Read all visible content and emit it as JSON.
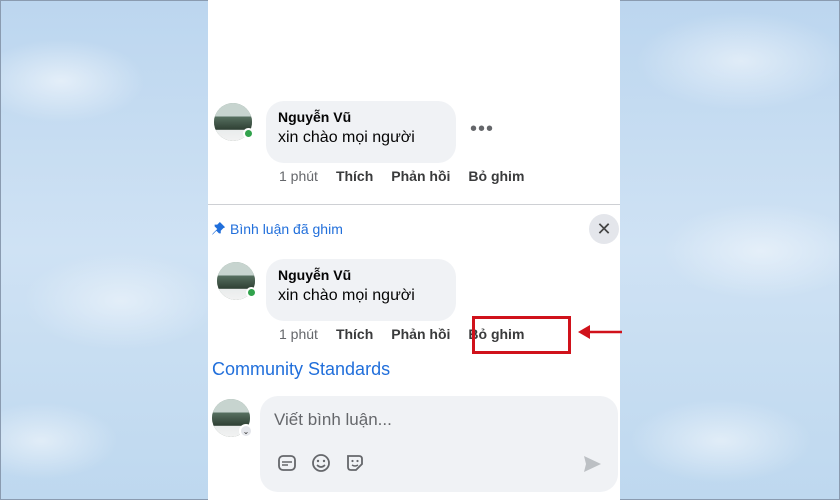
{
  "comment": {
    "author": "Nguyễn Vũ",
    "text": "xin chào mọi người",
    "time": "1 phút",
    "like": "Thích",
    "reply": "Phản hồi",
    "unpin": "Bỏ ghim",
    "more": "•••"
  },
  "pinned_section": {
    "label": "Bình luận đã ghim",
    "close": "✕",
    "comment": {
      "author": "Nguyễn Vũ",
      "text": "xin chào mọi người",
      "time": "1 phút",
      "like": "Thích",
      "reply": "Phản hồi",
      "unpin": "Bỏ ghim"
    }
  },
  "community_link": "Community Standards",
  "composer": {
    "placeholder": "Viết bình luận...",
    "avatar_badge": "⌄"
  },
  "colors": {
    "accent": "#216fdb",
    "highlight": "#d0121b",
    "online": "#31a24c"
  },
  "icons": [
    "pin-icon",
    "close-icon",
    "gif-icon",
    "emoji-icon",
    "sticker-icon",
    "send-icon",
    "arrow-icon"
  ]
}
